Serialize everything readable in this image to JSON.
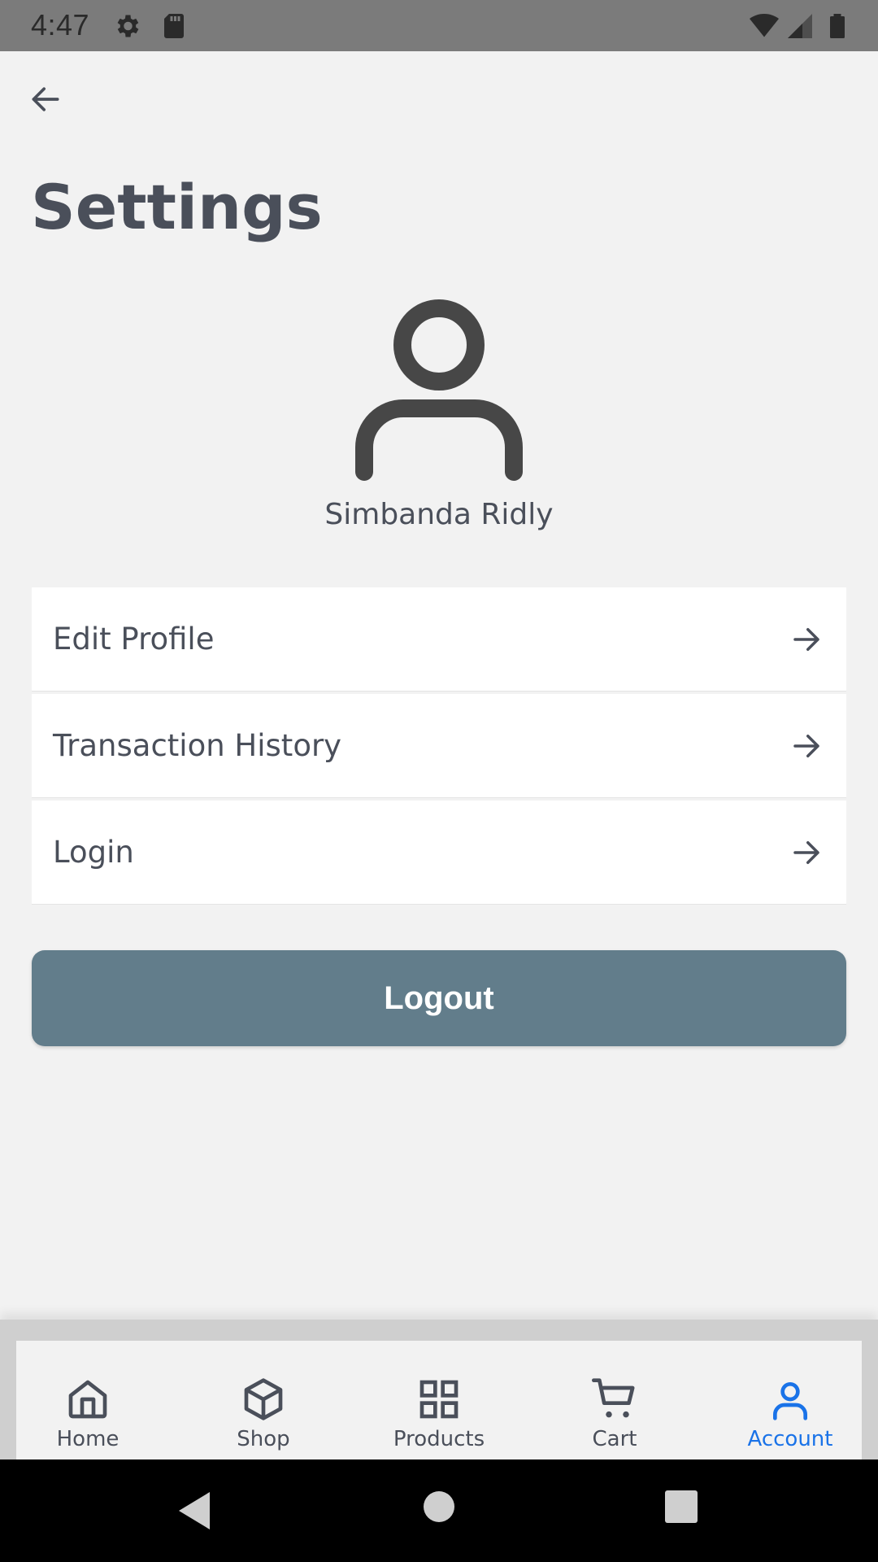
{
  "status_bar": {
    "time": "4:47",
    "icons": [
      "gear-icon",
      "sd-card-icon",
      "wifi-icon",
      "signal-icon",
      "battery-icon"
    ]
  },
  "header": {
    "back_icon": "arrow-left-icon",
    "title": "Settings"
  },
  "profile": {
    "avatar_icon": "person-icon",
    "name": "Simbanda Ridly"
  },
  "menu": {
    "items": [
      {
        "label": "Edit Profile",
        "icon": "arrow-right-icon"
      },
      {
        "label": "Transaction History",
        "icon": "arrow-right-icon"
      },
      {
        "label": "Login",
        "icon": "arrow-right-icon"
      }
    ]
  },
  "logout": {
    "label": "Logout",
    "color": "#627d8b"
  },
  "bottom_nav": {
    "active": "Account",
    "active_color": "#1a73e8",
    "items": [
      {
        "label": "Home",
        "icon": "home-icon"
      },
      {
        "label": "Shop",
        "icon": "box-icon"
      },
      {
        "label": "Products",
        "icon": "grid-icon"
      },
      {
        "label": "Cart",
        "icon": "cart-icon"
      },
      {
        "label": "Account",
        "icon": "person-icon"
      }
    ]
  },
  "system_nav": {
    "icons": [
      "back-triangle-icon",
      "home-circle-icon",
      "recents-square-icon"
    ]
  }
}
